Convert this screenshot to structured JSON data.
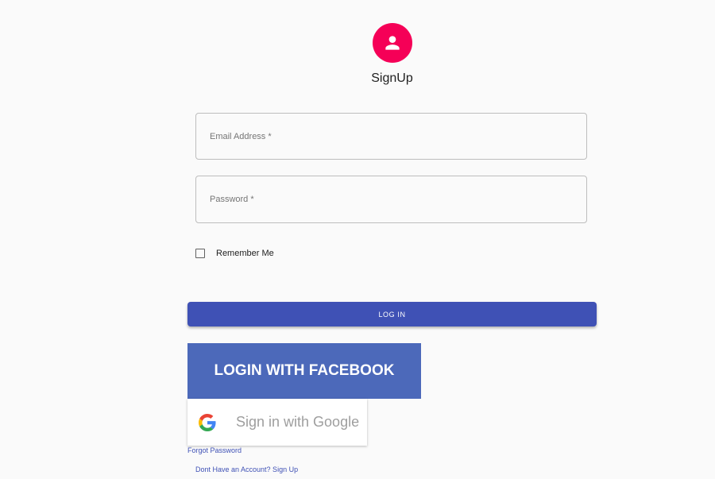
{
  "header": {
    "title": "SignUp",
    "avatar_icon": "person-icon",
    "avatar_color": "#f50057"
  },
  "form": {
    "email_label": "Email Address *",
    "password_label": "Password *",
    "remember_label": "Remember Me",
    "remember_checked": false,
    "login_label": "LOG IN",
    "login_color": "#3f51b5"
  },
  "social": {
    "facebook_label": "LOGIN WITH FACEBOOK",
    "facebook_color": "#4c69ba",
    "google_label": "Sign in with Google",
    "google_icon": "google-g-icon"
  },
  "links": {
    "forgot": "Forgot Password",
    "signup": "Dont Have an Account? Sign Up"
  }
}
